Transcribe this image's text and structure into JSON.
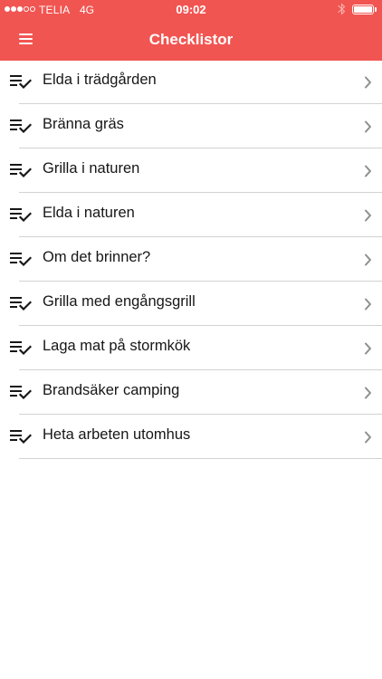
{
  "status_bar": {
    "carrier": "TELIA",
    "network": "4G",
    "time": "09:02",
    "signal_filled": 3,
    "signal_total": 5,
    "battery_level": 1.0
  },
  "header": {
    "title": "Checklistor",
    "menu_icon": "hamburger-menu-icon"
  },
  "checklist": {
    "item_icon": "checklist-icon",
    "chevron_icon": "chevron-right-icon",
    "items": [
      {
        "label": "Elda i trädgården"
      },
      {
        "label": "Bränna gräs"
      },
      {
        "label": "Grilla i naturen"
      },
      {
        "label": "Elda i naturen"
      },
      {
        "label": "Om det brinner?"
      },
      {
        "label": "Grilla med engångsgrill"
      },
      {
        "label": "Laga mat på stormkök"
      },
      {
        "label": "Brandsäker camping"
      },
      {
        "label": "Heta arbeten utomhus"
      }
    ]
  },
  "colors": {
    "accent": "#f15551",
    "header_text": "#ffffff",
    "item_text": "#161616",
    "divider": "#d3d3d3",
    "chevron": "#8e8e8e",
    "background": "#ffffff"
  }
}
